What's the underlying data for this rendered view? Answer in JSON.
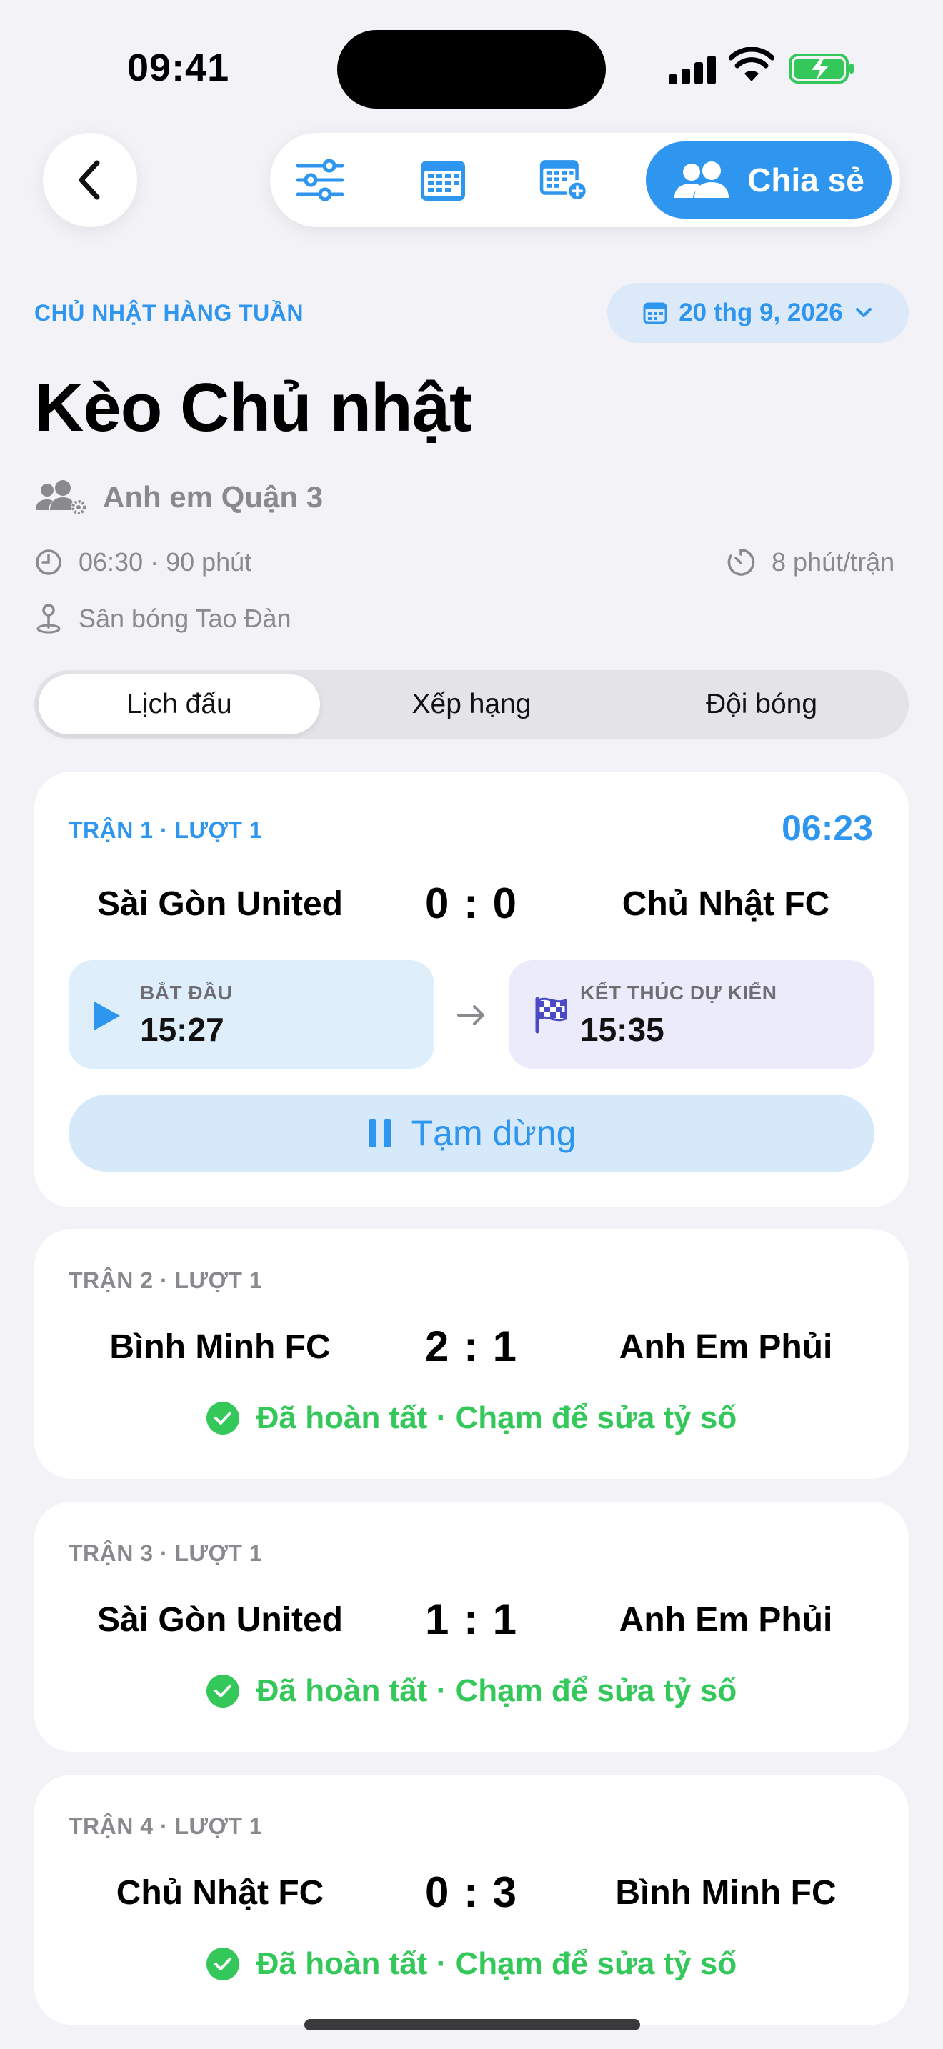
{
  "status_bar": {
    "time": "09:41"
  },
  "toolbar": {
    "share_label": "Chia sẻ"
  },
  "header": {
    "kicker": "CHỦ NHẬT HÀNG TUẦN",
    "date": "20 thg 9, 2026",
    "title": "Kèo Chủ nhật",
    "group": "Anh em Quận 3",
    "time_duration": "06:30 · 90 phút",
    "per_match": "8 phút/trận",
    "venue": "Sân bóng Tao Đàn"
  },
  "tabs": [
    {
      "label": "Lịch đấu",
      "active": true
    },
    {
      "label": "Xếp hạng",
      "active": false
    },
    {
      "label": "Đội bóng",
      "active": false
    }
  ],
  "colors": {
    "accent": "#2f96f0",
    "success": "#34c759",
    "finish_tint": "#ebebfb",
    "start_tint": "#deeefb"
  },
  "live_match": {
    "label": "TRẬN 1 · LƯỢT 1",
    "timer": "06:23",
    "home": "Sài Gòn United",
    "score": "0 : 0",
    "away": "Chủ Nhật FC",
    "start_label": "BẮT ĐẦU",
    "start_time": "15:27",
    "end_label": "KẾT THÚC DỰ KIẾN",
    "end_time": "15:35",
    "pause_label": "Tạm dừng"
  },
  "matches": [
    {
      "label": "TRẬN 2 · LƯỢT 1",
      "home": "Bình Minh FC",
      "score": "2 : 1",
      "away": "Anh Em Phủi",
      "status": "Đã hoàn tất · Chạm để sửa tỷ số"
    },
    {
      "label": "TRẬN 3 · LƯỢT 1",
      "home": "Sài Gòn United",
      "score": "1 : 1",
      "away": "Anh Em Phủi",
      "status": "Đã hoàn tất · Chạm để sửa tỷ số"
    },
    {
      "label": "TRẬN 4 · LƯỢT 1",
      "home": "Chủ Nhật FC",
      "score": "0 : 3",
      "away": "Bình Minh FC",
      "status": "Đã hoàn tất · Chạm để sửa tỷ số"
    }
  ]
}
